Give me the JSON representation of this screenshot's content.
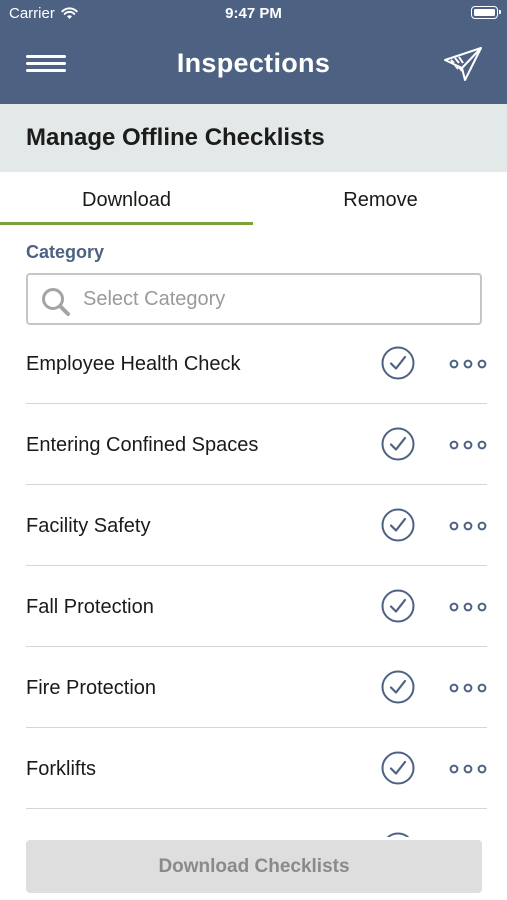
{
  "status_bar": {
    "carrier": "Carrier",
    "time": "9:47 PM"
  },
  "header": {
    "title": "Inspections",
    "menu_icon": "hamburger-menu-icon",
    "logo_icon": "app-logo-icon"
  },
  "subheader": {
    "title": "Manage Offline Checklists"
  },
  "tabs": [
    {
      "label": "Download",
      "active": true
    },
    {
      "label": "Remove",
      "active": false
    }
  ],
  "category": {
    "label": "Category",
    "placeholder": "Select Category"
  },
  "checklists": [
    {
      "name": "Employee Health Check",
      "selected": true
    },
    {
      "name": "Entering Confined Spaces",
      "selected": true
    },
    {
      "name": "Facility Safety",
      "selected": true
    },
    {
      "name": "Fall Protection",
      "selected": true
    },
    {
      "name": "Fire Protection",
      "selected": true
    },
    {
      "name": "Forklifts",
      "selected": true
    }
  ],
  "footer": {
    "button_label": "Download Checklists"
  },
  "colors": {
    "header_bg": "#4d6282",
    "subheader_bg": "#e3e9e8",
    "active_tab_underline": "#7aa23c",
    "accent_text": "#4d6282",
    "disabled_button_bg": "#dedede"
  }
}
